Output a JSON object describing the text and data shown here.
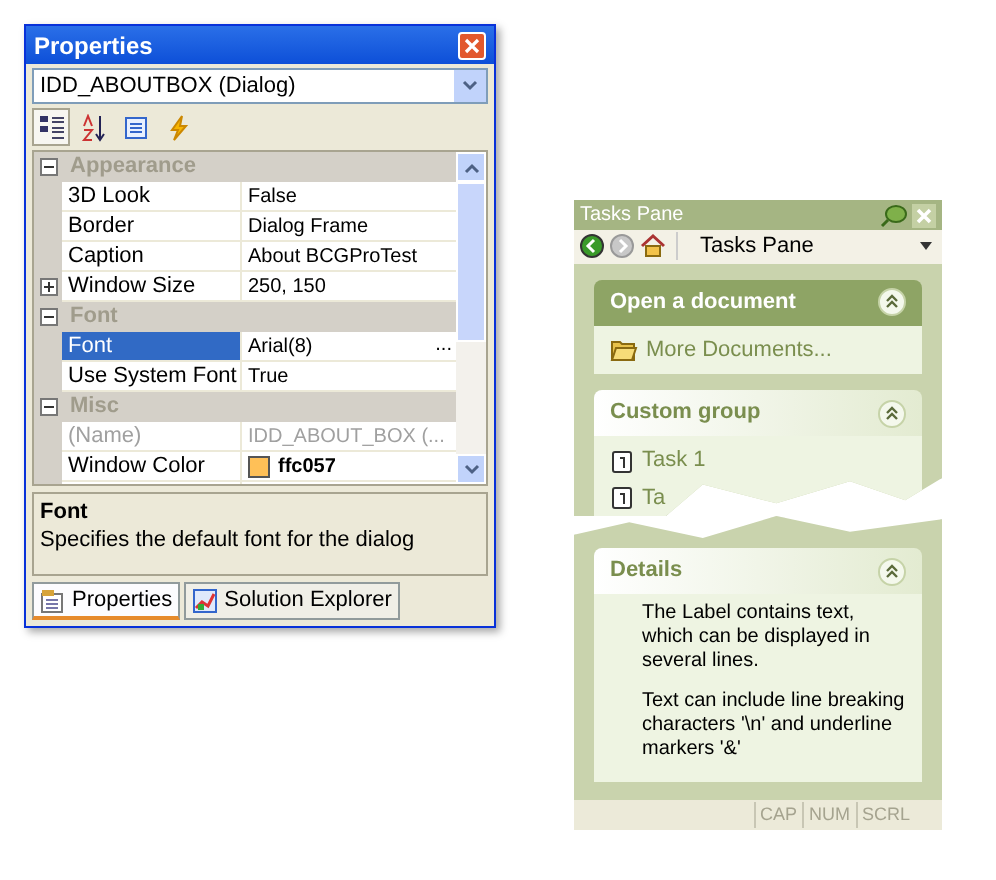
{
  "properties_window": {
    "title": "Properties",
    "object_selector": {
      "value": "IDD_ABOUTBOX (Dialog)"
    },
    "toolbar": [
      {
        "kind": "categorized",
        "selected": true
      },
      {
        "kind": "alphabetical",
        "selected": false
      },
      {
        "kind": "pages",
        "selected": false
      },
      {
        "kind": "events",
        "selected": false
      }
    ],
    "grid": [
      {
        "kind": "category",
        "name": "Appearance",
        "expanded": true
      },
      {
        "kind": "property",
        "name": "3D Look",
        "value": "False",
        "selected": false,
        "disabled": false
      },
      {
        "kind": "property",
        "name": "Border",
        "value": "Dialog Frame",
        "selected": false,
        "disabled": false
      },
      {
        "kind": "property",
        "name": "Caption",
        "value": "About BCGProTest",
        "selected": false,
        "disabled": false
      },
      {
        "kind": "property",
        "name": "Window Size",
        "value": "250, 150",
        "selected": false,
        "disabled": false,
        "expanded": false
      },
      {
        "kind": "category",
        "name": "Font",
        "expanded": true
      },
      {
        "kind": "property",
        "name": "Font",
        "value": "Arial(8)",
        "selected": true,
        "disabled": false,
        "button": "..."
      },
      {
        "kind": "property",
        "name": "Use System Font",
        "value": "True",
        "selected": false,
        "disabled": false
      },
      {
        "kind": "category",
        "name": "Misc",
        "expanded": true
      },
      {
        "kind": "property",
        "name": "(Name)",
        "value": "IDD_ABOUT_BOX (...",
        "selected": false,
        "disabled": true
      },
      {
        "kind": "property",
        "name": "Window Color",
        "value": "ffc057",
        "selected": false,
        "disabled": false,
        "color": "#ffc057"
      },
      {
        "kind": "cutoff"
      }
    ],
    "description": {
      "title": "Font",
      "text": "Specifies the default font for the dialog"
    },
    "tabs": [
      {
        "label": "Properties",
        "selected": true
      },
      {
        "label": "Solution Explorer",
        "selected": false
      }
    ]
  },
  "tasks_pane": {
    "title": "Tasks Pane",
    "toolbar": {
      "back_disabled": false,
      "forward_disabled": true,
      "selector": "Tasks Pane"
    },
    "groups": [
      {
        "title": "Open a document",
        "special": true,
        "expanded": true,
        "items": [
          {
            "label": "More Documents...",
            "kind": "folder"
          }
        ]
      },
      {
        "title": "Custom group",
        "special": false,
        "expanded": true,
        "items": [
          {
            "label": "Task 1",
            "kind": "task1"
          },
          {
            "label": "Ta",
            "kind": "task2"
          }
        ]
      },
      {
        "title": "Details",
        "special": false,
        "expanded": true,
        "paragraphs": [
          "The Label contains text, which can be displayed in several lines.",
          "Text can include line breaking characters '\\n' and underline markers '&'"
        ]
      }
    ],
    "status_bar": [
      "CAP",
      "NUM",
      "SCRL"
    ]
  }
}
